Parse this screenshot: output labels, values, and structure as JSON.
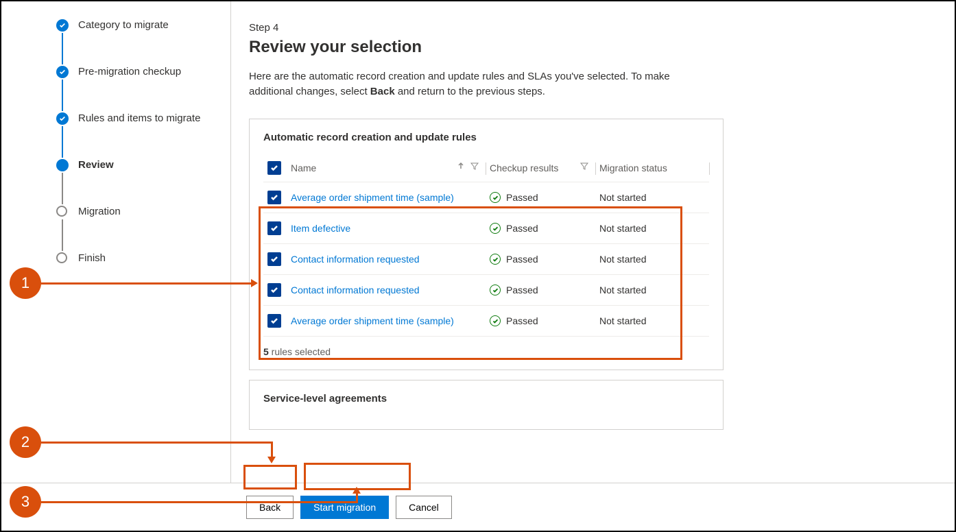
{
  "sidebar": {
    "steps": [
      {
        "label": "Category to migrate",
        "state": "done"
      },
      {
        "label": "Pre-migration checkup",
        "state": "done"
      },
      {
        "label": "Rules and items to migrate",
        "state": "done"
      },
      {
        "label": "Review",
        "state": "current"
      },
      {
        "label": "Migration",
        "state": "pending"
      },
      {
        "label": "Finish",
        "state": "pending"
      }
    ]
  },
  "header": {
    "step_caption": "Step 4",
    "title": "Review your selection",
    "intro_pre": "Here are the automatic record creation and update rules and SLAs you've selected. To make additional changes, select ",
    "intro_bold": "Back",
    "intro_post": " and return to the previous steps."
  },
  "rules_card": {
    "title": "Automatic record creation and update rules",
    "columns": {
      "name": "Name",
      "checkup": "Checkup results",
      "status": "Migration status"
    },
    "rows": [
      {
        "name": "Average order shipment time (sample)",
        "result": "Passed",
        "status": "Not started"
      },
      {
        "name": "Item defective",
        "result": "Passed",
        "status": "Not started"
      },
      {
        "name": "Contact information requested",
        "result": "Passed",
        "status": "Not started"
      },
      {
        "name": "Contact information requested",
        "result": "Passed",
        "status": "Not started"
      },
      {
        "name": "Average order shipment time (sample)",
        "result": "Passed",
        "status": "Not started"
      }
    ],
    "count_num": "5",
    "count_text": " rules selected"
  },
  "sla_card": {
    "title": "Service-level agreements"
  },
  "footer": {
    "back": "Back",
    "start": "Start migration",
    "cancel": "Cancel"
  },
  "annotations": {
    "a1": "1",
    "a2": "2",
    "a3": "3"
  }
}
